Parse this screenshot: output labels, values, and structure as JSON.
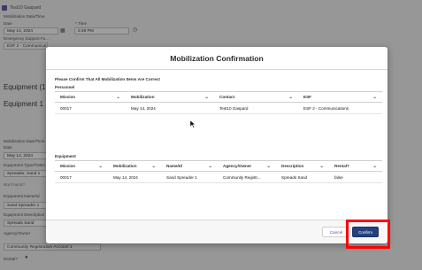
{
  "background": {
    "record_name": "Test10 Gaspard",
    "mobilization_date_time_label": "Mobilization Date/Time",
    "date_label": "Date",
    "time_label": "* Time",
    "date_value": "May 14, 2024",
    "time_value": "2:48 PM",
    "emergency_support_label": "Emergency Support Fu...",
    "esf_value": "ESF 2 - Communicat...",
    "equipment_count_heading": "Equipment (1)",
    "equipment_1_heading": "Equipment 1",
    "demob_date_time_label": "Mobilization Date/Time",
    "date_label_2": "Date",
    "date_value_2": "May 14, 2024",
    "equipment_type_label": "Equipment Type/TDMA...",
    "equipment_type_value": "Spreader, Sand 1",
    "not_found_text": "Not Found?",
    "equipment_name_label": "Equipment Name/Id",
    "equipment_name_value": "Sand Spreader 1",
    "equipment_desc_label": "Equipment Description",
    "equipment_desc_value": "Spreads Sand",
    "agency_owner_label": "Agency/Owner",
    "agency_owner_value": "Community Registration Account 1",
    "rental_label": "Rental?"
  },
  "modal": {
    "title": "Mobilization Confirmation",
    "instruction": "Please Confirm That All Mobilization Items Are Correct",
    "personnel": {
      "label": "Personnel",
      "columns": [
        "Mission",
        "Mobilization",
        "Contact",
        "ESF"
      ],
      "rows": [
        [
          "00017",
          "May 14, 2024",
          "Test10 Gaspard",
          "ESF 2 - Communications"
        ]
      ]
    },
    "equipment": {
      "label": "Equipment",
      "columns": [
        "Mission",
        "Mobilization",
        "Name/Id",
        "Agency/Owner",
        "Description",
        "Rental?"
      ],
      "rows": [
        [
          "00017",
          "May 14, 2024",
          "Sand Spreader 1",
          "Community Registr...",
          "Spreads Sand",
          "false"
        ]
      ]
    },
    "cancel_label": "Cancel",
    "confirm_label": "Confirm"
  },
  "colors": {
    "confirm_button": "#24407e",
    "highlight_box": "#ff0000",
    "brand_square": "#5a3fa3"
  },
  "icons": [
    "chevron-down-icon",
    "calendar-icon",
    "clock-icon",
    "mouse-cursor-icon"
  ]
}
